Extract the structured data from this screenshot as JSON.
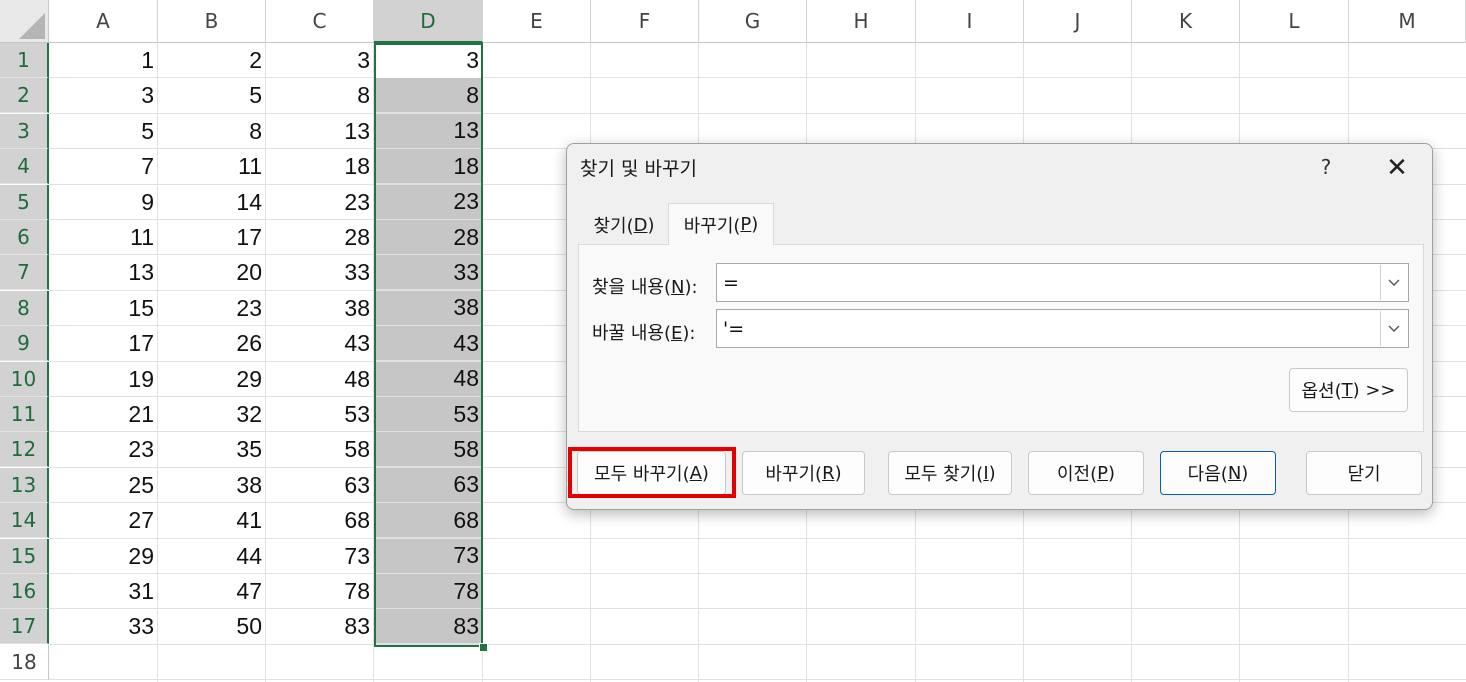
{
  "sheet": {
    "columns": [
      "A",
      "B",
      "C",
      "D",
      "E",
      "F",
      "G",
      "H",
      "I",
      "J",
      "K",
      "L",
      "M"
    ],
    "selected_column": "D",
    "rows": [
      {
        "n": "1",
        "vals": [
          "1",
          "2",
          "3",
          "3"
        ]
      },
      {
        "n": "2",
        "vals": [
          "3",
          "5",
          "8",
          "8"
        ]
      },
      {
        "n": "3",
        "vals": [
          "5",
          "8",
          "13",
          "13"
        ]
      },
      {
        "n": "4",
        "vals": [
          "7",
          "11",
          "18",
          "18"
        ]
      },
      {
        "n": "5",
        "vals": [
          "9",
          "14",
          "23",
          "23"
        ]
      },
      {
        "n": "6",
        "vals": [
          "11",
          "17",
          "28",
          "28"
        ]
      },
      {
        "n": "7",
        "vals": [
          "13",
          "20",
          "33",
          "33"
        ]
      },
      {
        "n": "8",
        "vals": [
          "15",
          "23",
          "38",
          "38"
        ]
      },
      {
        "n": "9",
        "vals": [
          "17",
          "26",
          "43",
          "43"
        ]
      },
      {
        "n": "10",
        "vals": [
          "19",
          "29",
          "48",
          "48"
        ]
      },
      {
        "n": "11",
        "vals": [
          "21",
          "32",
          "53",
          "53"
        ]
      },
      {
        "n": "12",
        "vals": [
          "23",
          "35",
          "58",
          "58"
        ]
      },
      {
        "n": "13",
        "vals": [
          "25",
          "38",
          "63",
          "63"
        ]
      },
      {
        "n": "14",
        "vals": [
          "27",
          "41",
          "68",
          "68"
        ]
      },
      {
        "n": "15",
        "vals": [
          "29",
          "44",
          "73",
          "73"
        ]
      },
      {
        "n": "16",
        "vals": [
          "31",
          "47",
          "78",
          "78"
        ]
      },
      {
        "n": "17",
        "vals": [
          "33",
          "50",
          "83",
          "83"
        ]
      },
      {
        "n": "18",
        "vals": [
          "",
          "",
          "",
          ""
        ]
      }
    ],
    "selection": "D1:D17",
    "accent_color": "#217346"
  },
  "dialog": {
    "title": "찾기 및 바꾸기",
    "help": "?",
    "close": "✕",
    "tabs": {
      "find": {
        "prefix": "찾기(",
        "key": "D",
        "suffix": ")"
      },
      "replace": {
        "prefix": "바꾸기(",
        "key": "P",
        "suffix": ")"
      }
    },
    "active_tab": "replace",
    "find_what": {
      "prefix": "찾을 내용(",
      "key": "N",
      "suffix": "):",
      "value": "="
    },
    "replace_with": {
      "prefix": "바꿀 내용(",
      "key": "E",
      "suffix": "):",
      "value": "'="
    },
    "options_button": {
      "prefix": "옵션(",
      "key": "T",
      "suffix": ") >>"
    },
    "buttons": {
      "replace_all": {
        "prefix": "모두 바꾸기(",
        "key": "A",
        "suffix": ")"
      },
      "replace": {
        "prefix": "바꾸기(",
        "key": "R",
        "suffix": ")"
      },
      "find_all": {
        "prefix": "모두 찾기(",
        "key": "I",
        "suffix": ")"
      },
      "previous": {
        "prefix": "이전(",
        "key": "P",
        "suffix": ")"
      },
      "next": {
        "prefix": "다음(",
        "key": "N",
        "suffix": ")"
      },
      "close": "닫기"
    },
    "highlight_color": "#e30000"
  }
}
